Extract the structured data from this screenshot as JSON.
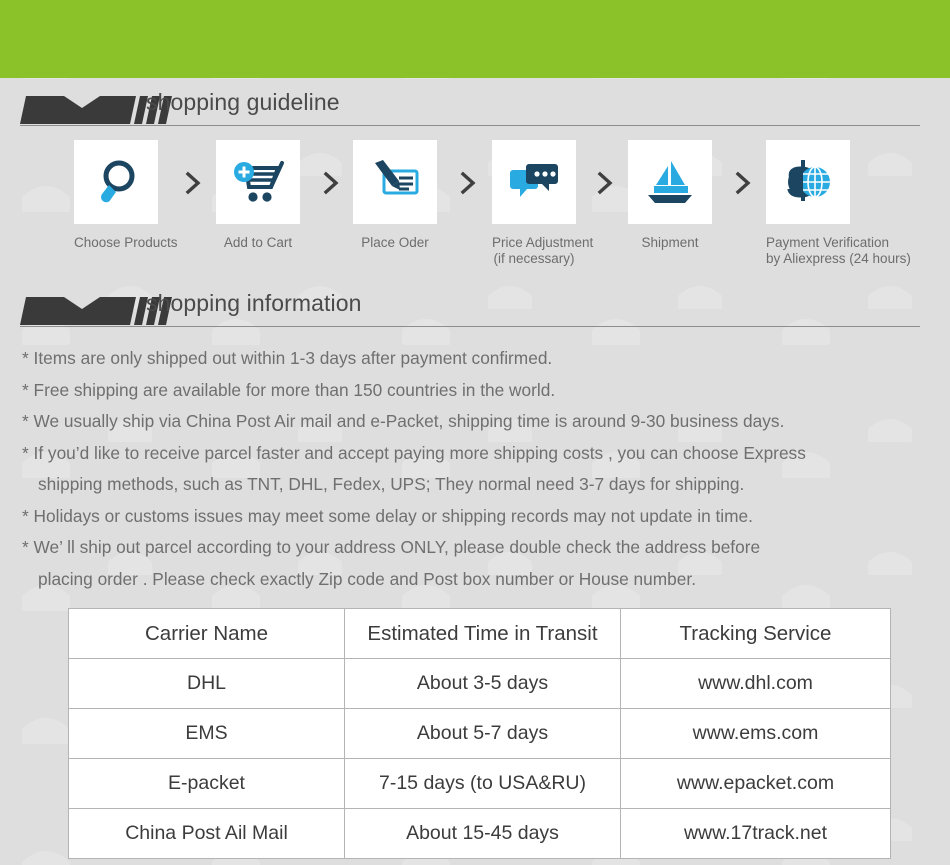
{
  "theme": {
    "banner_green": "#8cc229",
    "page_background": "#dedede",
    "heading_bar_dark": "#3a3a3a",
    "heading_text": "#4a4a4a",
    "body_text": "#6f6f6f",
    "icon_dark_blue": "#1b4560",
    "icon_light_blue": "#29abe2",
    "table_border": "#b4b4b4",
    "table_cell_background": "#ffffff"
  },
  "sections": {
    "guideline": {
      "title": "shopping guideline"
    },
    "information": {
      "title": "shopping information"
    }
  },
  "steps": [
    {
      "icon": "magnifier-icon",
      "label_line1": "Choose Products",
      "label_line2": ""
    },
    {
      "icon": "add-to-cart-icon",
      "label_line1": "Add to Cart",
      "label_line2": ""
    },
    {
      "icon": "pen-check-icon",
      "label_line1": "Place Oder",
      "label_line2": ""
    },
    {
      "icon": "chat-bubbles-icon",
      "label_line1": "Price Adjustment",
      "label_line2": "(if necessary)"
    },
    {
      "icon": "sailboat-icon",
      "label_line1": "Shipment",
      "label_line2": ""
    },
    {
      "icon": "dollar-globe-icon",
      "label_line1": "Payment Verification",
      "label_line2": "by  Aliexpress (24 hours)"
    }
  ],
  "step_separator": "chevron-right-icon",
  "info_lines": [
    {
      "text": "* Items are only shipped out within 1-3 days after payment confirmed.",
      "indent": false
    },
    {
      "text": "* Free shipping are available for more than 150 countries in the world.",
      "indent": false
    },
    {
      "text": "* We usually ship via China Post Air mail and e-Packet, shipping time is around 9-30 business days.",
      "indent": false
    },
    {
      "text": "* If you’d like to receive parcel faster and accept paying more shipping costs , you can choose Express",
      "indent": false
    },
    {
      "text": "shipping methods, such as TNT, DHL, Fedex, UPS; They normal need 3-7 days for shipping.",
      "indent": true
    },
    {
      "text": "* Holidays or customs issues may meet some delay or shipping records may not update in time.",
      "indent": false
    },
    {
      "text": "* We’ ll ship out parcel according to your address ONLY, please double check the address before",
      "indent": false
    },
    {
      "text": "placing order . Please check exactly Zip code and Post box number or House number.",
      "indent": true
    }
  ],
  "carrier_table": {
    "headers": [
      "Carrier Name",
      "Estimated Time in Transit",
      "Tracking Service"
    ],
    "rows": [
      [
        "DHL",
        "About 3-5 days",
        "www.dhl.com"
      ],
      [
        "EMS",
        "About 5-7 days",
        "www.ems.com"
      ],
      [
        "E-packet",
        "7-15 days (to USA&RU)",
        "www.epacket.com"
      ],
      [
        "China Post Ail Mail",
        "About 15-45 days",
        "www.17track.net"
      ]
    ]
  }
}
